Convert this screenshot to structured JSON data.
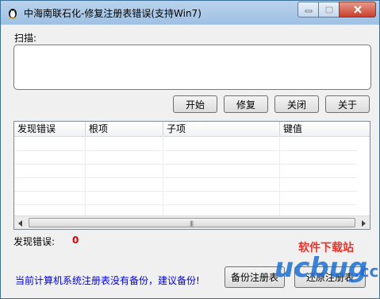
{
  "window": {
    "title": "中海南联石化-修复注册表错误(支持Win7)"
  },
  "scan": {
    "label": "扫描:",
    "value": ""
  },
  "toolbar": {
    "start_label": "开始",
    "repair_label": "修复",
    "close_label": "关闭",
    "about_label": "关于"
  },
  "table": {
    "columns": [
      "发现错误",
      "根项",
      "子项",
      "键值"
    ],
    "rows": []
  },
  "summary": {
    "errors_label": "发现错误:",
    "errors_count": "0"
  },
  "status": {
    "text": "当前计算机系统注册表没有备份，建议备份!"
  },
  "actions": {
    "backup_label": "备份注册表",
    "restore_label": "还原注册表"
  },
  "watermark": {
    "brand": "ucbug",
    "tld": ".cc",
    "cn": "软件下载站"
  },
  "colors": {
    "titlebar": "#a9c8e8",
    "status_text": "#0000e0",
    "error_count": "#e00000",
    "watermark_blue": "#1d6fd1",
    "watermark_red": "#e8322a"
  }
}
